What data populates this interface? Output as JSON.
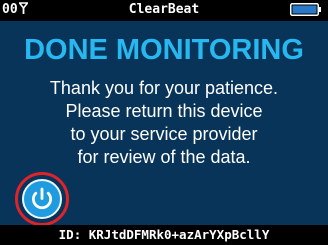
{
  "status_bar": {
    "signal": "00",
    "app_title": "ClearBeat",
    "battery_icon": "battery-full-icon"
  },
  "main": {
    "headline": "DONE MONITORING",
    "message_lines": [
      "Thank you for your patience.",
      "Please return this device",
      "to your service provider",
      "for review of the data."
    ],
    "power_icon": "power-icon"
  },
  "footer": {
    "id_text": "ID: KRJtdDFMRk0+azArYXpBcllY"
  },
  "colors": {
    "background": "#073458",
    "accent": "#27b8f2",
    "power_ring": "#e0232a",
    "bar": "#000000"
  }
}
